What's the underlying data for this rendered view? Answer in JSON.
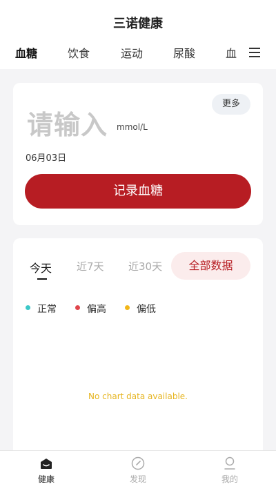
{
  "header": {
    "title": "三诺健康"
  },
  "tabs": [
    {
      "label": "血糖",
      "active": true
    },
    {
      "label": "饮食",
      "active": false
    },
    {
      "label": "运动",
      "active": false
    },
    {
      "label": "尿酸",
      "active": false
    },
    {
      "label": "血",
      "active": false
    }
  ],
  "menu_icon": "menu-icon",
  "entry_card": {
    "placeholder": "请输入",
    "unit": "mmol/L",
    "more_label": "更多",
    "date": "06月03日",
    "record_label": "记录血糖"
  },
  "history_card": {
    "ranges": [
      {
        "label": "今天",
        "active": true
      },
      {
        "label": "近7天",
        "active": false
      },
      {
        "label": "近30天",
        "active": false
      }
    ],
    "all_label": "全部数据",
    "legend": [
      {
        "label": "正常",
        "color": "#3cc8c8"
      },
      {
        "label": "偏高",
        "color": "#e0454b"
      },
      {
        "label": "偏低",
        "color": "#f2b619"
      }
    ],
    "empty_text": "No chart data available."
  },
  "bottom_nav": [
    {
      "label": "健康",
      "icon": "home-icon",
      "active": true
    },
    {
      "label": "发现",
      "icon": "compass-icon",
      "active": false
    },
    {
      "label": "我的",
      "icon": "user-icon",
      "active": false
    }
  ],
  "colors": {
    "accent": "#b71d23",
    "accent_light": "#fbecec"
  }
}
